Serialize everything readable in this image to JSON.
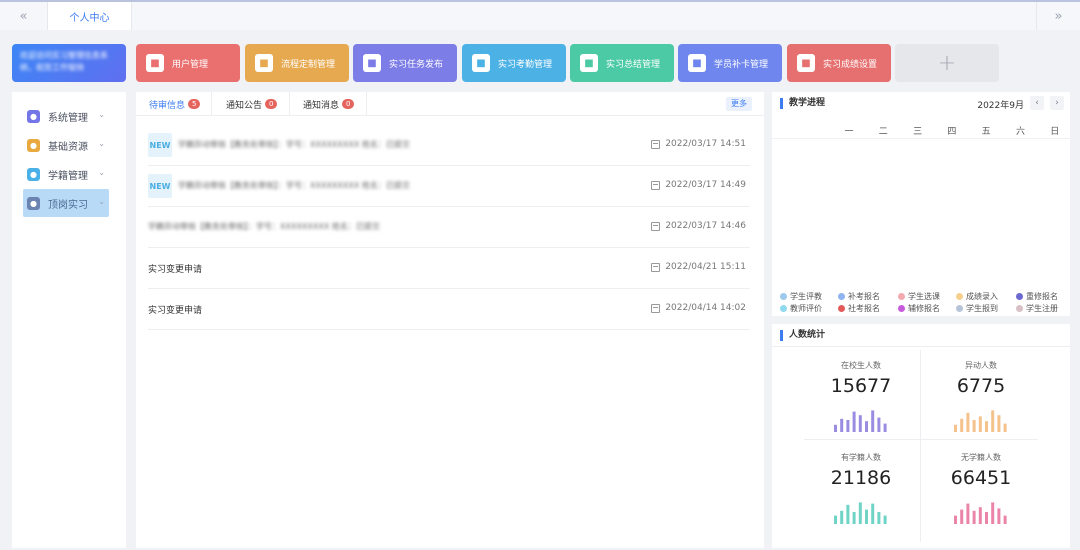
{
  "topbar": {
    "collapse_left": "«",
    "active_tab": "个人中心",
    "collapse_right": "»"
  },
  "welcome": {
    "text": "欢迎访问实习管理信息系统，祝您工作愉快"
  },
  "shortcuts": [
    {
      "label": "用户管理",
      "color": "#ea6f6f",
      "icon": "user-card-icon"
    },
    {
      "label": "流程定制管理",
      "color": "#e7a94f",
      "icon": "workflow-icon"
    },
    {
      "label": "实习任务发布",
      "color": "#7d7de8",
      "icon": "star-task-icon"
    },
    {
      "label": "实习考勤管理",
      "color": "#4cb2e6",
      "icon": "attendance-icon"
    },
    {
      "label": "实习总结管理",
      "color": "#4ccaa6",
      "icon": "summary-icon"
    },
    {
      "label": "学员补卡管理",
      "color": "#6f86ee",
      "icon": "card-icon"
    },
    {
      "label": "实习成绩设置",
      "color": "#e66f6f",
      "icon": "grade-icon"
    }
  ],
  "shortcut_add": "+",
  "sidebar": {
    "items": [
      {
        "label": "系统管理",
        "color": "#7476e8",
        "icon": "gear-icon",
        "active": false
      },
      {
        "label": "基础资源",
        "color": "#e8a93f",
        "icon": "resource-icon",
        "active": false
      },
      {
        "label": "学籍管理",
        "color": "#4ab1e8",
        "icon": "book-icon",
        "active": false
      },
      {
        "label": "顶岗实习",
        "color": "#6b83b0",
        "icon": "person-icon",
        "active": true
      }
    ]
  },
  "messages": {
    "tabs": [
      {
        "label": "待审信息",
        "count": "5"
      },
      {
        "label": "通知公告",
        "count": "0"
      },
      {
        "label": "通知消息",
        "count": "0"
      }
    ],
    "more": "更多",
    "items": [
      {
        "badge": "NEW",
        "title": "",
        "blurred": "学籍异动审核【教务处审核】：学号：XXXXXXXXX 姓名：已提交",
        "time": "2022/03/17 14:51"
      },
      {
        "badge": "NEW",
        "title": "",
        "blurred": "学籍异动审核【教务处审核】：学号：XXXXXXXXX 姓名：已提交",
        "time": "2022/03/17 14:49"
      },
      {
        "badge": "",
        "title": "",
        "blurred": "学籍异动审核【教务处审核】：学号：XXXXXXXXX 姓名：已提交",
        "time": "2022/03/17 14:46"
      },
      {
        "badge": "",
        "title": "实习变更申请",
        "blurred": "",
        "time": "2022/04/21 15:11"
      },
      {
        "badge": "",
        "title": "实习变更申请",
        "blurred": "",
        "time": "2022/04/14 14:02"
      }
    ]
  },
  "calendar": {
    "title": "教学进程",
    "month": "2022年9月",
    "prev": "‹",
    "next": "›",
    "weekdays": [
      "一",
      "二",
      "三",
      "四",
      "五",
      "六",
      "日"
    ],
    "legend": [
      {
        "label": "学生评教",
        "color": "#9ec9ea"
      },
      {
        "label": "补考报名",
        "color": "#8fb4ef"
      },
      {
        "label": "学生选课",
        "color": "#f3a9b0"
      },
      {
        "label": "成绩录入",
        "color": "#f4cf8e"
      },
      {
        "label": "重修报名",
        "color": "#6b68d0"
      },
      {
        "label": "教师评价",
        "color": "#8fd9ee"
      },
      {
        "label": "社考报名",
        "color": "#e25a5a"
      },
      {
        "label": "辅修报名",
        "color": "#c65cdb"
      },
      {
        "label": "学生报到",
        "color": "#b7c3d6"
      },
      {
        "label": "学生注册",
        "color": "#d8c0c6"
      }
    ]
  },
  "stats": {
    "title": "人数统计",
    "cells": [
      {
        "label": "在校生人数",
        "value": "15677",
        "color": "#9a8ce0",
        "bars": [
          0.3,
          0.55,
          0.5,
          0.85,
          0.7,
          0.45,
          0.9,
          0.6,
          0.35
        ]
      },
      {
        "label": "异动人数",
        "value": "6775",
        "color": "#f4c28a",
        "bars": [
          0.3,
          0.55,
          0.8,
          0.5,
          0.65,
          0.45,
          0.9,
          0.7,
          0.35
        ]
      },
      {
        "label": "有学籍人数",
        "value": "21186",
        "color": "#6fd4c6",
        "bars": [
          0.35,
          0.55,
          0.8,
          0.5,
          0.9,
          0.6,
          0.85,
          0.5,
          0.35
        ]
      },
      {
        "label": "无学籍人数",
        "value": "66451",
        "color": "#ea84a8",
        "bars": [
          0.35,
          0.6,
          0.85,
          0.55,
          0.7,
          0.5,
          0.9,
          0.65,
          0.35
        ]
      }
    ]
  }
}
